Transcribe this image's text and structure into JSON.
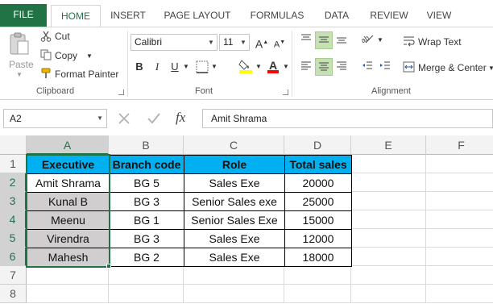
{
  "ribbon_tabs": [
    "FILE",
    "HOME",
    "INSERT",
    "PAGE LAYOUT",
    "FORMULAS",
    "DATA",
    "REVIEW",
    "VIEW"
  ],
  "clipboard": {
    "paste": "Paste",
    "cut": "Cut",
    "copy": "Copy",
    "format_painter": "Format Painter",
    "group": "Clipboard"
  },
  "font": {
    "name": "Calibri",
    "size": "11",
    "bold": "B",
    "italic": "I",
    "underline": "U",
    "font_color_glyph": "A",
    "highlight_color": "#ffff00",
    "font_color": "#ff0000",
    "group": "Font"
  },
  "alignment": {
    "wrap_text": "Wrap Text",
    "merge_center": "Merge & Center",
    "group": "Alignment"
  },
  "formula_bar": {
    "name_box": "A2",
    "fx": "fx",
    "value": "Amit Shrama"
  },
  "grid": {
    "columns": [
      "A",
      "B",
      "C",
      "D",
      "E",
      "F"
    ],
    "rows": [
      "1",
      "2",
      "3",
      "4",
      "5",
      "6",
      "7",
      "8"
    ],
    "headers": [
      "Executive",
      "Branch code",
      "Role",
      "Total sales"
    ],
    "data": [
      [
        "Amit Shrama",
        "BG 5",
        "Sales Exe",
        "20000"
      ],
      [
        "Kunal B",
        "BG 3",
        "Senior Sales exe",
        "25000"
      ],
      [
        "Meenu",
        "BG 1",
        "Senior Sales Exe",
        "15000"
      ],
      [
        "Virendra",
        "BG 3",
        "Sales Exe",
        "12000"
      ],
      [
        "Mahesh",
        "BG 2",
        "Sales Exe",
        "18000"
      ]
    ],
    "header_fill": "#00b0f0",
    "selection_fill": "#d0cece",
    "accent": "#217346"
  }
}
